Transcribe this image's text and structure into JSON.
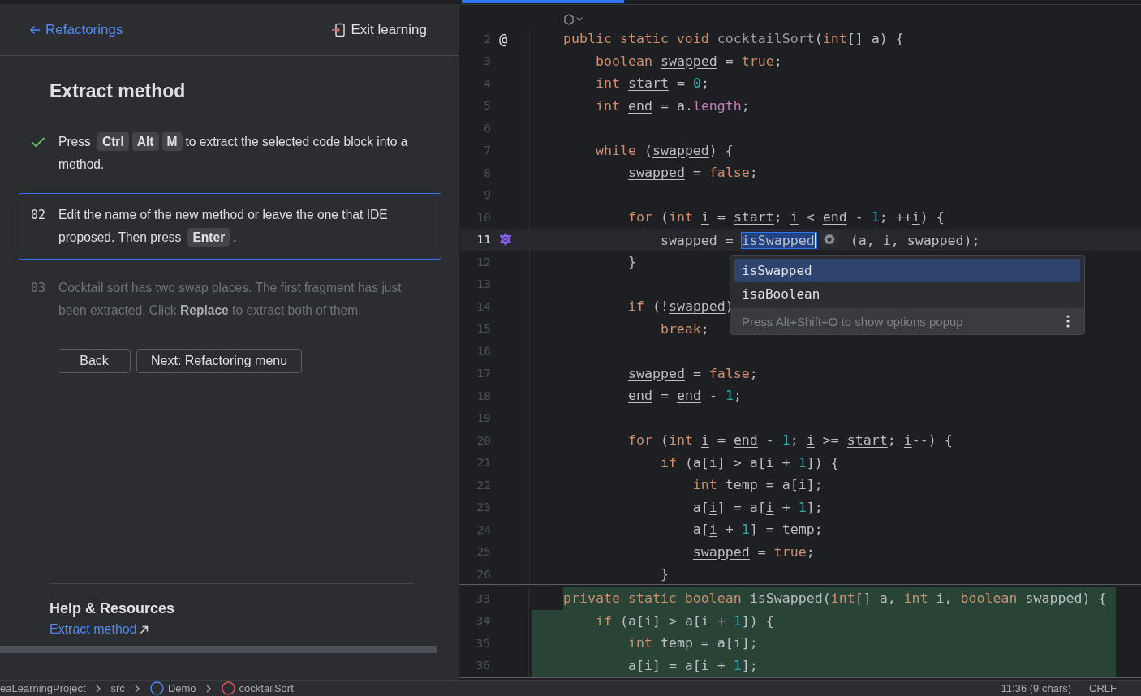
{
  "header": {
    "back_link": "Refactorings",
    "exit_button": "Exit learning"
  },
  "lesson": {
    "title": "Extract method",
    "steps": [
      {
        "completed": true,
        "active": false,
        "parts": [
          {
            "kind": "text",
            "text": "Press"
          },
          {
            "kind": "key",
            "text": "Ctrl"
          },
          {
            "kind": "key",
            "text": "Alt"
          },
          {
            "kind": "key",
            "text": "M"
          },
          {
            "kind": "text",
            "text": "to extract the selected code block into a method."
          }
        ]
      },
      {
        "completed": false,
        "active": true,
        "number": "02",
        "parts": [
          {
            "kind": "text",
            "text": "Edit the name of the new method or leave the one that IDE proposed. Then press"
          },
          {
            "kind": "key",
            "text": "Enter"
          },
          {
            "kind": "text",
            "text": "."
          }
        ]
      },
      {
        "completed": false,
        "active": false,
        "number": "03",
        "parts": [
          {
            "kind": "text",
            "text": "Cocktail sort has two swap places. The first fragment has just been extracted. Click **Replace** to extract both of them."
          }
        ]
      }
    ],
    "buttons": [
      "Back",
      "Next: Refactoring menu"
    ]
  },
  "help": {
    "title": "Help & Resources",
    "links": [
      "Extract method"
    ]
  },
  "editor": {
    "lines": [
      {
        "number": "2",
        "gutter": "@",
        "current": false,
        "tokens": [
          {
            "kind": "kw",
            "text": "public static void "
          },
          {
            "kind": "unused",
            "text": "cocktailSort"
          },
          {
            "kind": "plain",
            "text": "("
          },
          {
            "kind": "kw",
            "text": "int"
          },
          {
            "kind": "plain",
            "text": "[] a) {"
          }
        ]
      },
      {
        "number": "3",
        "current": false,
        "tokens": [
          {
            "kind": "kw",
            "text": "    boolean "
          },
          {
            "kind": "var",
            "text": "swapped"
          },
          {
            "kind": "plain",
            "text": " = "
          },
          {
            "kind": "kw",
            "text": "true"
          },
          {
            "kind": "plain",
            "text": ";"
          }
        ]
      },
      {
        "number": "4",
        "current": false,
        "tokens": [
          {
            "kind": "kw",
            "text": "    int "
          },
          {
            "kind": "var",
            "text": "start"
          },
          {
            "kind": "plain",
            "text": " = "
          },
          {
            "kind": "num",
            "text": "0"
          },
          {
            "kind": "plain",
            "text": ";"
          }
        ]
      },
      {
        "number": "5",
        "current": false,
        "tokens": [
          {
            "kind": "kw",
            "text": "    int "
          },
          {
            "kind": "var",
            "text": "end"
          },
          {
            "kind": "plain",
            "text": " = a."
          },
          {
            "kind": "field",
            "text": "length"
          },
          {
            "kind": "plain",
            "text": ";"
          }
        ]
      },
      {
        "number": "6",
        "current": false
      },
      {
        "number": "7",
        "current": false,
        "tokens": [
          {
            "kind": "kw",
            "text": "    while"
          },
          {
            "kind": "plain",
            "text": " ("
          },
          {
            "kind": "var",
            "text": "swapped"
          },
          {
            "kind": "plain",
            "text": ") {"
          }
        ]
      },
      {
        "number": "8",
        "current": false,
        "tokens": [
          {
            "kind": "var",
            "text": "        swapped"
          },
          {
            "kind": "plain",
            "text": " = "
          },
          {
            "kind": "kw",
            "text": "false"
          },
          {
            "kind": "plain",
            "text": ";"
          }
        ]
      },
      {
        "number": "9",
        "current": false
      },
      {
        "number": "10",
        "current": false,
        "tokens": [
          {
            "kind": "kw",
            "text": "        for"
          },
          {
            "kind": "plain",
            "text": " ("
          },
          {
            "kind": "kw",
            "text": "int "
          },
          {
            "kind": "var",
            "text": "i"
          },
          {
            "kind": "plain",
            "text": " = "
          },
          {
            "kind": "var",
            "text": "start"
          },
          {
            "kind": "plain",
            "text": "; "
          },
          {
            "kind": "var",
            "text": "i"
          },
          {
            "kind": "plain",
            "text": " < "
          },
          {
            "kind": "var",
            "text": "end"
          },
          {
            "kind": "plain",
            "text": " - "
          },
          {
            "kind": "num",
            "text": "1"
          },
          {
            "kind": "plain",
            "text": "; ++"
          },
          {
            "kind": "var",
            "text": "i"
          },
          {
            "kind": "plain",
            "text": ") {"
          }
        ]
      },
      {
        "number": "11",
        "current": true,
        "tokens": [
          {
            "kind": "plain",
            "text": "            swapped = "
          },
          {
            "kind": "rename",
            "text": "isSwapped"
          },
          {
            "kind": "plain",
            "text": " (a, i, swapped);"
          }
        ]
      },
      {
        "number": "12",
        "current": false,
        "tokens": [
          {
            "kind": "plain",
            "text": "        }"
          }
        ]
      },
      {
        "number": "13",
        "current": false
      },
      {
        "number": "14",
        "current": false,
        "tokens": [
          {
            "kind": "kw",
            "text": "        if"
          },
          {
            "kind": "plain",
            "text": " (!"
          },
          {
            "kind": "var",
            "text": "swapped"
          },
          {
            "kind": "plain",
            "text": ")"
          }
        ]
      },
      {
        "number": "15",
        "current": false,
        "tokens": [
          {
            "kind": "kw",
            "text": "            break"
          },
          {
            "kind": "plain",
            "text": ";"
          }
        ]
      },
      {
        "number": "16",
        "current": false
      },
      {
        "number": "17",
        "current": false,
        "tokens": [
          {
            "kind": "var",
            "text": "        swapped"
          },
          {
            "kind": "plain",
            "text": " = "
          },
          {
            "kind": "kw",
            "text": "false"
          },
          {
            "kind": "plain",
            "text": ";"
          }
        ]
      },
      {
        "number": "18",
        "current": false,
        "tokens": [
          {
            "kind": "var",
            "text": "        end"
          },
          {
            "kind": "plain",
            "text": " = "
          },
          {
            "kind": "var",
            "text": "end"
          },
          {
            "kind": "plain",
            "text": " - "
          },
          {
            "kind": "num",
            "text": "1"
          },
          {
            "kind": "plain",
            "text": ";"
          }
        ]
      },
      {
        "number": "19",
        "current": false
      },
      {
        "number": "20",
        "current": false,
        "tokens": [
          {
            "kind": "kw",
            "text": "        for"
          },
          {
            "kind": "plain",
            "text": " ("
          },
          {
            "kind": "kw",
            "text": "int "
          },
          {
            "kind": "var",
            "text": "i"
          },
          {
            "kind": "plain",
            "text": " = "
          },
          {
            "kind": "var",
            "text": "end"
          },
          {
            "kind": "plain",
            "text": " - "
          },
          {
            "kind": "num",
            "text": "1"
          },
          {
            "kind": "plain",
            "text": "; "
          },
          {
            "kind": "var",
            "text": "i"
          },
          {
            "kind": "plain",
            "text": " >= "
          },
          {
            "kind": "var",
            "text": "start"
          },
          {
            "kind": "plain",
            "text": "; "
          },
          {
            "kind": "var",
            "text": "i"
          },
          {
            "kind": "plain",
            "text": "--) {"
          }
        ]
      },
      {
        "number": "21",
        "current": false,
        "tokens": [
          {
            "kind": "kw",
            "text": "            if"
          },
          {
            "kind": "plain",
            "text": " (a["
          },
          {
            "kind": "var",
            "text": "i"
          },
          {
            "kind": "plain",
            "text": "] > a["
          },
          {
            "kind": "var",
            "text": "i"
          },
          {
            "kind": "plain",
            "text": " + "
          },
          {
            "kind": "num",
            "text": "1"
          },
          {
            "kind": "plain",
            "text": "]) {"
          }
        ]
      },
      {
        "number": "22",
        "current": false,
        "tokens": [
          {
            "kind": "kw",
            "text": "                int"
          },
          {
            "kind": "plain",
            "text": " temp = a["
          },
          {
            "kind": "var",
            "text": "i"
          },
          {
            "kind": "plain",
            "text": "];"
          }
        ]
      },
      {
        "number": "23",
        "current": false,
        "tokens": [
          {
            "kind": "plain",
            "text": "                a["
          },
          {
            "kind": "var",
            "text": "i"
          },
          {
            "kind": "plain",
            "text": "] = a["
          },
          {
            "kind": "var",
            "text": "i"
          },
          {
            "kind": "plain",
            "text": " + "
          },
          {
            "kind": "num",
            "text": "1"
          },
          {
            "kind": "plain",
            "text": "];"
          }
        ]
      },
      {
        "number": "24",
        "current": false,
        "tokens": [
          {
            "kind": "plain",
            "text": "                a["
          },
          {
            "kind": "var",
            "text": "i"
          },
          {
            "kind": "plain",
            "text": " + "
          },
          {
            "kind": "num",
            "text": "1"
          },
          {
            "kind": "plain",
            "text": "] = temp;"
          }
        ]
      },
      {
        "number": "25",
        "current": false,
        "tokens": [
          {
            "kind": "var",
            "text": "                swapped"
          },
          {
            "kind": "plain",
            "text": " = "
          },
          {
            "kind": "kw",
            "text": "true"
          },
          {
            "kind": "plain",
            "text": ";"
          }
        ]
      },
      {
        "number": "26",
        "current": false,
        "tokens": [
          {
            "kind": "plain",
            "text": "            }"
          }
        ]
      }
    ],
    "completion": {
      "items": [
        {
          "text": "isSwapped",
          "selected": true
        },
        {
          "text": "isaBoolean",
          "selected": false
        }
      ],
      "hint": "Press Alt+Shift+O to show options popup"
    },
    "preview_lines": [
      {
        "number": "33",
        "tokens": [
          {
            "kind": "kw",
            "text": "private static boolean "
          },
          {
            "kind": "plain",
            "text": "isSwapped("
          },
          {
            "kind": "kw",
            "text": "int"
          },
          {
            "kind": "plain",
            "text": "[] a, "
          },
          {
            "kind": "kw",
            "text": "int"
          },
          {
            "kind": "plain",
            "text": " i, "
          },
          {
            "kind": "kw",
            "text": "boolean"
          },
          {
            "kind": "plain",
            "text": " swapped) {"
          }
        ]
      },
      {
        "number": "34",
        "tokens": [
          {
            "kind": "kw",
            "text": "    if"
          },
          {
            "kind": "plain",
            "text": " (a[i] > a[i + "
          },
          {
            "kind": "num",
            "text": "1"
          },
          {
            "kind": "plain",
            "text": "]) {"
          }
        ]
      },
      {
        "number": "35",
        "tokens": [
          {
            "kind": "kw",
            "text": "        int"
          },
          {
            "kind": "plain",
            "text": " temp = a[i];"
          }
        ]
      },
      {
        "number": "36",
        "tokens": [
          {
            "kind": "plain",
            "text": "        a[i] = a[i + "
          },
          {
            "kind": "num",
            "text": "1"
          },
          {
            "kind": "plain",
            "text": "];"
          }
        ]
      }
    ]
  },
  "status_bar": {
    "breadcrumbs": [
      {
        "kind": "folder",
        "text": "eaLearningProject"
      },
      {
        "kind": "folder",
        "text": "src"
      },
      {
        "kind": "class",
        "text": "Demo"
      },
      {
        "kind": "method",
        "text": "cocktailSort"
      }
    ],
    "position": "11:36 (9 chars)",
    "line_ending": "CRLF"
  }
}
